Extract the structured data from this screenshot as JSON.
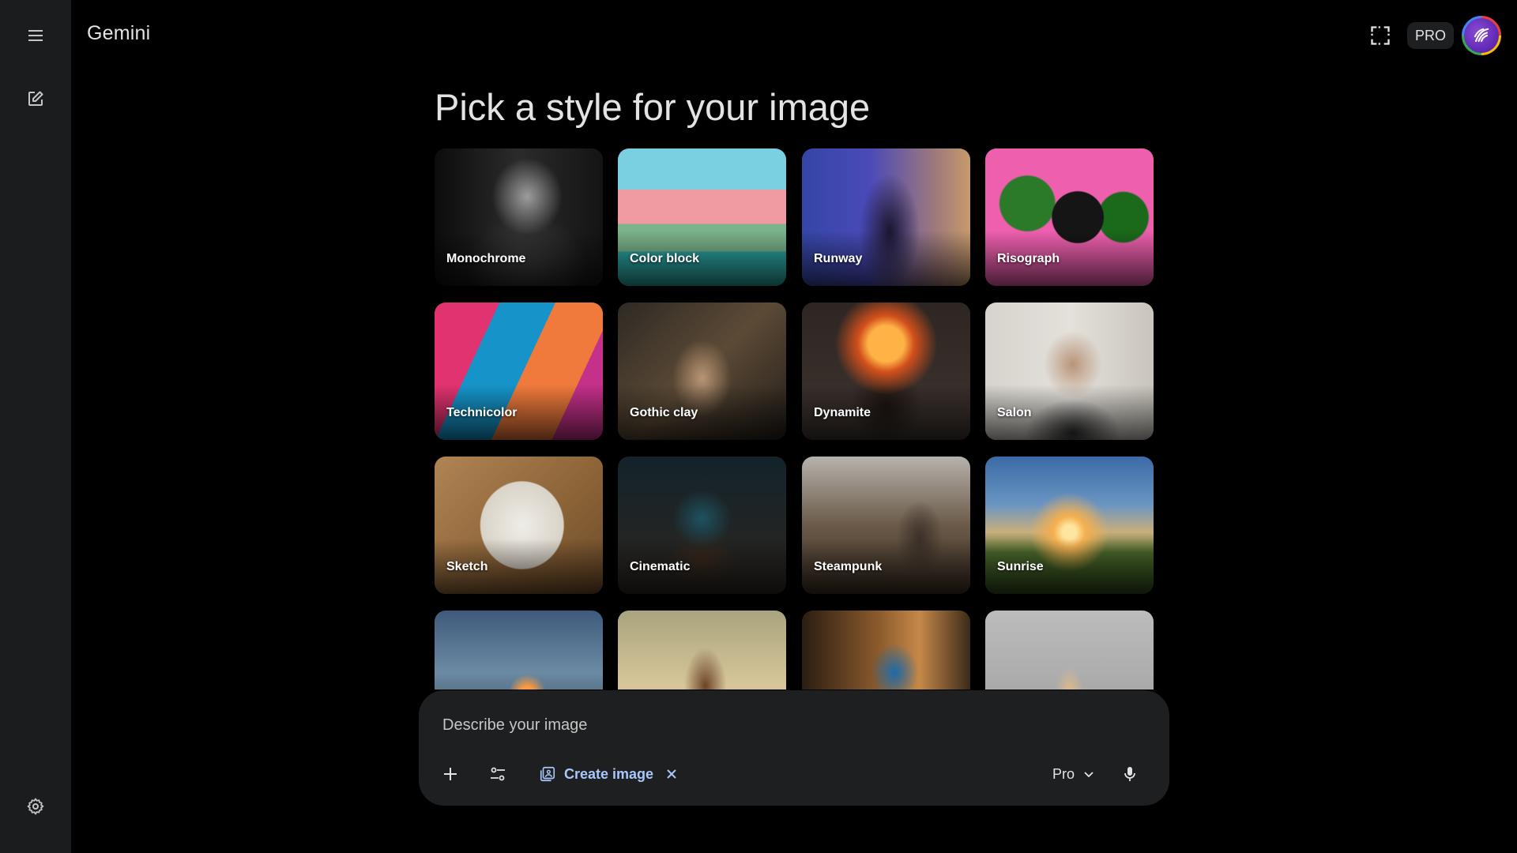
{
  "app": {
    "title": "Gemini"
  },
  "sidebar": {
    "menu_icon": "menu-icon",
    "new_chat_icon": "edit-square-icon",
    "settings_icon": "gear-icon"
  },
  "header": {
    "screenshot_icon": "screen-capture-icon",
    "pro_badge": "PRO",
    "avatar_icon": "avatar-icon"
  },
  "main": {
    "title": "Pick a style for your image",
    "styles": [
      {
        "label": "Monochrome"
      },
      {
        "label": "Color block"
      },
      {
        "label": "Runway"
      },
      {
        "label": "Risograph"
      },
      {
        "label": "Technicolor"
      },
      {
        "label": "Gothic clay"
      },
      {
        "label": "Dynamite"
      },
      {
        "label": "Salon"
      },
      {
        "label": "Sketch"
      },
      {
        "label": "Cinematic"
      },
      {
        "label": "Steampunk"
      },
      {
        "label": "Sunrise"
      }
    ]
  },
  "prompt": {
    "placeholder": "Describe your image",
    "value": "",
    "add_icon": "plus-icon",
    "tools_icon": "tune-icon",
    "chip_label": "Create image",
    "chip_icon": "image-gallery-icon",
    "chip_close_icon": "close-icon",
    "model_label": "Pro",
    "model_icon": "chevron-down-icon",
    "mic_icon": "mic-icon"
  },
  "colors": {
    "background": "#000000",
    "sidebar": "#1b1c1d",
    "prompt_bg": "#1e1f20",
    "accent": "#a8c7fa",
    "text": "#e3e3e3"
  }
}
